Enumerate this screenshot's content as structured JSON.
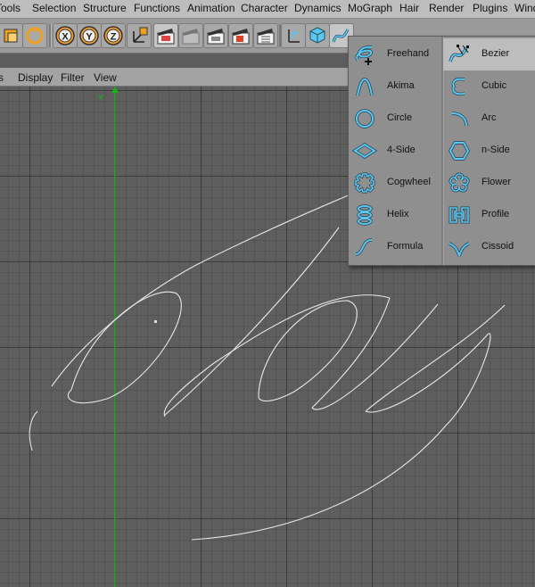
{
  "menubar": {
    "items": [
      "Tools",
      "Selection",
      "Structure",
      "Functions",
      "Animation",
      "Character",
      "Dynamics",
      "MoGraph",
      "Hair",
      "Render",
      "Plugins",
      "Window"
    ]
  },
  "view_menu": {
    "items": [
      "s",
      "Display",
      "Filter",
      "View"
    ]
  },
  "toolbar": {
    "axis_x_label": "X",
    "axis_y_label": "Y",
    "axis_z_label": "Z"
  },
  "viewport": {
    "axis_label": "Y"
  },
  "spline_menu": {
    "items": [
      {
        "label": "Freehand",
        "icon": "freehand-icon"
      },
      {
        "label": "Bezier",
        "icon": "bezier-icon",
        "selected": true
      },
      {
        "label": "Akima",
        "icon": "akima-icon"
      },
      {
        "label": "Cubic",
        "icon": "cubic-icon"
      },
      {
        "label": "Circle",
        "icon": "circle-icon"
      },
      {
        "label": "Arc",
        "icon": "arc-icon"
      },
      {
        "label": "4-Side",
        "icon": "four-side-icon"
      },
      {
        "label": "n-Side",
        "icon": "n-side-icon"
      },
      {
        "label": "Cogwheel",
        "icon": "cogwheel-icon"
      },
      {
        "label": "Flower",
        "icon": "flower-icon"
      },
      {
        "label": "Helix",
        "icon": "helix-icon"
      },
      {
        "label": "Profile",
        "icon": "profile-icon"
      },
      {
        "label": "Formula",
        "icon": "formula-icon"
      },
      {
        "label": "Cissoid",
        "icon": "cissoid-icon"
      }
    ]
  },
  "colors": {
    "icon_blue": "#5ec7f0",
    "grid_bg": "#5e5e5e",
    "y_axis": "#19b219"
  }
}
